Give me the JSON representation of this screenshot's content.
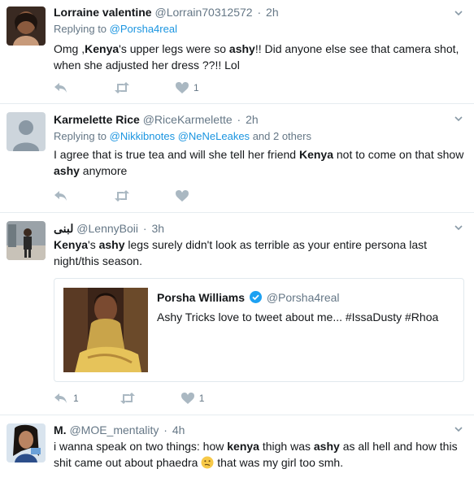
{
  "tweets": [
    {
      "name": "Lorraine valentine",
      "handle": "@Lorrain70312572",
      "time": "2h",
      "replying_label": "Replying to",
      "replying_handle": "@Porsha4real",
      "text_parts": [
        {
          "t": "Omg ,"
        },
        {
          "t": "Kenya",
          "b": true
        },
        {
          "t": "'s upper legs were so "
        },
        {
          "t": "ashy",
          "b": true
        },
        {
          "t": "!! Did anyone else see that camera shot, when she adjusted her dress ??!!  Lol"
        }
      ],
      "like_count": "1",
      "reply_count": "",
      "retweet_count": ""
    },
    {
      "name": "Karmelette Rice",
      "handle": "@RiceKarmelette",
      "time": "2h",
      "replying_label": "Replying to",
      "replying_handle_1": "@Nikkibnotes",
      "replying_handle_2": "@NeNeLeakes",
      "replying_more": "and 2 others",
      "text_parts": [
        {
          "t": "I agree that is true tea and will she tell her friend "
        },
        {
          "t": "Kenya",
          "b": true
        },
        {
          "t": " not to come on that show "
        },
        {
          "t": "ashy",
          "b": true
        },
        {
          "t": " anymore"
        }
      ],
      "like_count": "",
      "reply_count": "",
      "retweet_count": ""
    },
    {
      "name": "لبنى",
      "handle": "@LennyBoii",
      "time": "3h",
      "text_parts": [
        {
          "t": "Kenya",
          "b": true
        },
        {
          "t": "'s "
        },
        {
          "t": "ashy",
          "b": true
        },
        {
          "t": " legs surely didn't look as terrible as your entire persona last night/this season."
        }
      ],
      "quote": {
        "name": "Porsha Williams",
        "handle": "@Porsha4real",
        "text": "Ashy Tricks love to tweet about me... #IssaDusty #Rhoa"
      },
      "reply_count": "1",
      "retweet_count": "",
      "like_count": "1"
    },
    {
      "name": "M.",
      "handle": "@MOE_mentality",
      "time": "4h",
      "text_parts_line1": [
        {
          "t": "i wanna speak on two things: how "
        },
        {
          "t": "kenya",
          "b": true
        },
        {
          "t": " thigh was "
        },
        {
          "t": "ashy",
          "b": true
        },
        {
          "t": " as all hell and how this"
        }
      ],
      "text_line2_before": "shit came out about phaedra",
      "text_line2_after": " that was my girl too smh."
    }
  ],
  "colors": {
    "text": "#14171a",
    "muted": "#657786",
    "link": "#1b95e0",
    "border": "#e6ecf0",
    "verified": "#1da1f2"
  },
  "icons": [
    "reply-icon",
    "retweet-icon",
    "heart-icon",
    "chevron-down-icon",
    "verified-badge-icon",
    "confused-face-emoji"
  ]
}
